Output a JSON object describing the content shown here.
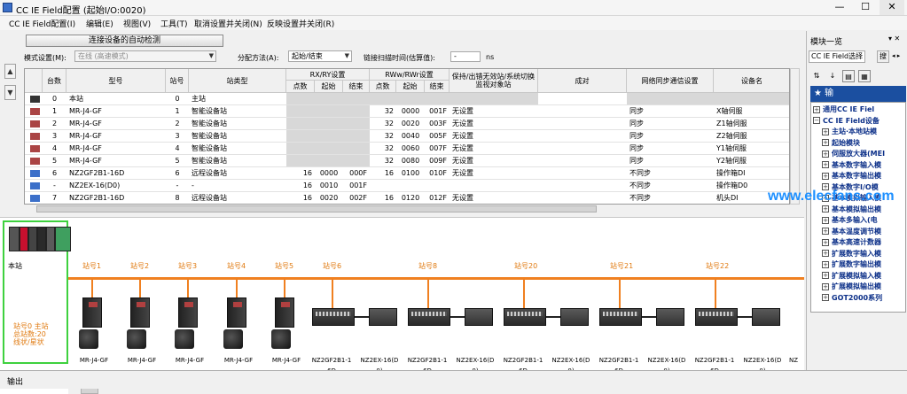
{
  "window": {
    "title": "CC IE Field配置 (起始I/O:0020)",
    "min": "—",
    "max": "☐",
    "close": "✕"
  },
  "menu": [
    "CC IE Field配置(I)",
    "编辑(E)",
    "视图(V)",
    "工具(T)",
    "取消设置并关闭(N)",
    "反映设置并关闭(R)"
  ],
  "mdi": {
    "restore": "▭",
    "close": "✕"
  },
  "toolbar": {
    "autodetect_label": "连接设备的自动检测",
    "mode_label": "模式设置(M):",
    "mode_value": "在线 (高速模式)",
    "assign_label": "分配方法(A):",
    "assign_value": "起始/结束",
    "scan_label": "链接扫描时间(估算值):",
    "scan_value": "-",
    "scan_unit": "ns"
  },
  "grid": {
    "headers": {
      "count": "台数",
      "model": "型号",
      "station": "站号",
      "type": "站类型",
      "rxry": "RX/RY设置",
      "rwrw": "RWw/RWr设置",
      "points": "点数",
      "start": "起始",
      "end": "结束",
      "hold": "保持/出错无效站/系统切换监视对象站",
      "pair": "成对",
      "sync": "网络同步通信设置",
      "name": "设备名"
    },
    "rows": [
      {
        "count": "0",
        "model": "本站",
        "station": "0",
        "type": "主站",
        "rx_pts": "",
        "rx_start": "",
        "rx_end": "",
        "rw_pts": "",
        "rw_start": "",
        "rw_end": "",
        "hold": "",
        "sync": "",
        "name": ""
      },
      {
        "count": "1",
        "model": "MR-J4-GF",
        "station": "1",
        "type": "智能设备站",
        "rx_pts": "",
        "rx_start": "",
        "rx_end": "",
        "rw_pts": "32",
        "rw_start": "0000",
        "rw_end": "001F",
        "hold": "无设置",
        "sync": "同步",
        "name": "X轴伺服"
      },
      {
        "count": "2",
        "model": "MR-J4-GF",
        "station": "2",
        "type": "智能设备站",
        "rx_pts": "",
        "rx_start": "",
        "rx_end": "",
        "rw_pts": "32",
        "rw_start": "0020",
        "rw_end": "003F",
        "hold": "无设置",
        "sync": "同步",
        "name": "Z1轴伺服"
      },
      {
        "count": "3",
        "model": "MR-J4-GF",
        "station": "3",
        "type": "智能设备站",
        "rx_pts": "",
        "rx_start": "",
        "rx_end": "",
        "rw_pts": "32",
        "rw_start": "0040",
        "rw_end": "005F",
        "hold": "无设置",
        "sync": "同步",
        "name": "Z2轴伺服"
      },
      {
        "count": "4",
        "model": "MR-J4-GF",
        "station": "4",
        "type": "智能设备站",
        "rx_pts": "",
        "rx_start": "",
        "rx_end": "",
        "rw_pts": "32",
        "rw_start": "0060",
        "rw_end": "007F",
        "hold": "无设置",
        "sync": "同步",
        "name": "Y1轴伺服"
      },
      {
        "count": "5",
        "model": "MR-J4-GF",
        "station": "5",
        "type": "智能设备站",
        "rx_pts": "",
        "rx_start": "",
        "rx_end": "",
        "rw_pts": "32",
        "rw_start": "0080",
        "rw_end": "009F",
        "hold": "无设置",
        "sync": "同步",
        "name": "Y2轴伺服"
      },
      {
        "count": "6",
        "model": "NZ2GF2B1-16D",
        "station": "6",
        "type": "远程设备站",
        "rx_pts": "16",
        "rx_start": "0000",
        "rx_end": "000F",
        "rw_pts": "16",
        "rw_start": "0100",
        "rw_end": "010F",
        "hold": "无设置",
        "sync": "不同步",
        "name": "操作箱DI"
      },
      {
        "count": "-",
        "model": "NZ2EX-16(D0)",
        "station": "-",
        "type": "-",
        "rx_pts": "16",
        "rx_start": "0010",
        "rx_end": "001F",
        "rw_pts": "",
        "rw_start": "",
        "rw_end": "",
        "hold": "",
        "sync": "不同步",
        "name": "操作箱D0"
      },
      {
        "count": "7",
        "model": "NZ2GF2B1-16D",
        "station": "8",
        "type": "远程设备站",
        "rx_pts": "16",
        "rx_start": "0020",
        "rx_end": "002F",
        "rw_pts": "16",
        "rw_start": "0120",
        "rw_end": "012F",
        "hold": "无设置",
        "sync": "不同步",
        "name": "机头DI"
      }
    ]
  },
  "diagram": {
    "host_label": "本站",
    "host_info": [
      "站号0  主站",
      "总站数:20",
      "线状/星状"
    ],
    "stations": [
      "站号1",
      "站号2",
      "站号3",
      "站号4",
      "站号5",
      "站号6",
      "站号8",
      "站号20",
      "站号21",
      "站号22"
    ],
    "devices": [
      "MR-J4-GF",
      "MR-J4-GF",
      "MR-J4-GF",
      "MR-J4-GF",
      "MR-J4-GF",
      "NZ2GF2B1-1\n6D",
      "NZ2EX-16(D\n0)",
      "NZ2GF2B1-1\n6D",
      "NZ2EX-16(D\n0)",
      "NZ2GF2B1-1\n6D",
      "NZ2EX-16(D\n0)",
      "NZ2GF2B1-1\n6D",
      "NZ2EX-16(D\n0)",
      "NZ2GF2B1-1\n6D",
      "NZ2EX-16(D\n0)",
      "NZ"
    ]
  },
  "modules": {
    "title": "模块一览",
    "tabs": [
      "CC IE Field选择",
      "搜"
    ],
    "header": "★ 输",
    "items": [
      "通用CC IE Fiel",
      "CC IE Field设备",
      "主站·本地站模",
      "起始模块",
      "伺服放大器(MEI",
      "基本数字输入模",
      "基本数字输出模",
      "基本数字I/O模",
      "基本模拟输入模",
      "基本模拟输出模",
      "基本多输入(电",
      "基本温度调节模",
      "基本高速计数器",
      "扩展数字输入模",
      "扩展数字输出模",
      "扩展模拟输入模",
      "扩展模拟输出模",
      "GOT2000系列"
    ]
  },
  "watermark": "www.elecfans.com",
  "output": {
    "label": "输出"
  }
}
